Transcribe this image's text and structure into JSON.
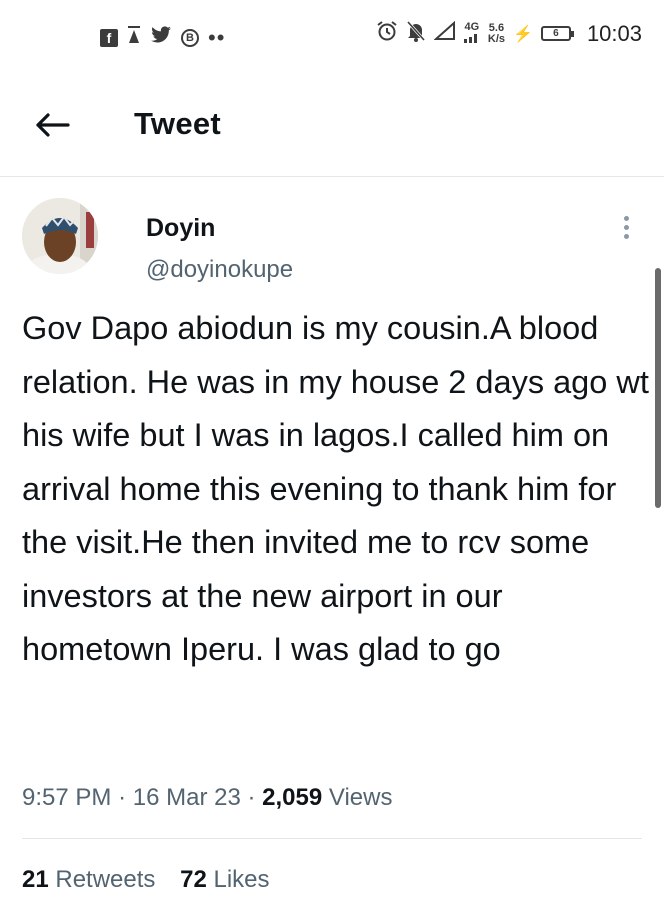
{
  "status_bar": {
    "left_icons": [
      "facebook-icon",
      "notification-icon",
      "twitter-icon",
      "b-icon",
      "more-dots-icon"
    ],
    "b_letter": "B",
    "network_type": "4G",
    "speed_value": "5.6",
    "speed_unit": "K/s",
    "battery_level": "6",
    "time": "10:03"
  },
  "header": {
    "title": "Tweet"
  },
  "tweet": {
    "author_name": "Doyin",
    "author_handle": "@doyinokupe",
    "text": "Gov Dapo abiodun is my cousin.A blood relation. He was in my house 2 days ago wt his wife but I was in lagos.I called him on arrival home this evening to thank him for the visit.He then invited me to rcv some investors at the new airport in our hometown Iperu. I was glad to go",
    "time": "9:57 PM",
    "separator": "·",
    "date": "16 Mar 23",
    "views_count": "2,059",
    "views_label": "Views",
    "retweets_count": "21",
    "retweets_label": "Retweets",
    "likes_count": "72",
    "likes_label": "Likes"
  },
  "colors": {
    "text_primary": "#0f1419",
    "text_secondary": "#536471",
    "divider": "#e3e7ea"
  }
}
